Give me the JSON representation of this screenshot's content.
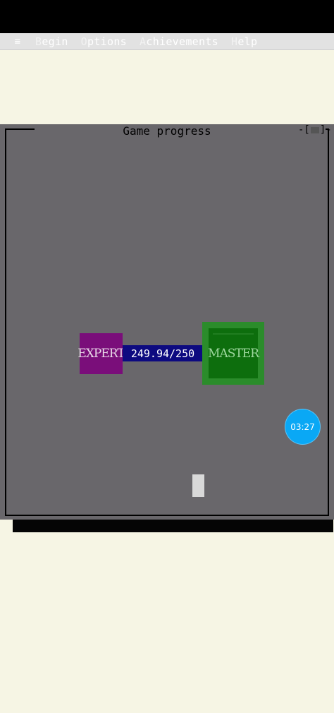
{
  "menu": {
    "hamburger_icon": "menu-icon",
    "items": [
      {
        "hot": "B",
        "rest": "egin"
      },
      {
        "hot": "O",
        "rest": "ptions"
      },
      {
        "hot": "A",
        "rest": "chievements"
      },
      {
        "hot": "H",
        "rest": "elp"
      }
    ]
  },
  "window": {
    "title": "Game progress",
    "close_left": "-[",
    "close_right": "]-"
  },
  "progress": {
    "from_rank": "EXPERT",
    "to_rank": "MASTER",
    "label": "249.94/250",
    "current": 249.94,
    "target": 250
  },
  "timer": {
    "time": "03:27"
  },
  "colors": {
    "window_bg": "#69676b",
    "expert": "#7a0e7a",
    "progress_bar": "#0d0a80",
    "master_outer": "#2b8c2b",
    "master_inner": "#0d6e0d",
    "timer": "#0aa8f5",
    "page_bg": "#f6f5e4"
  }
}
